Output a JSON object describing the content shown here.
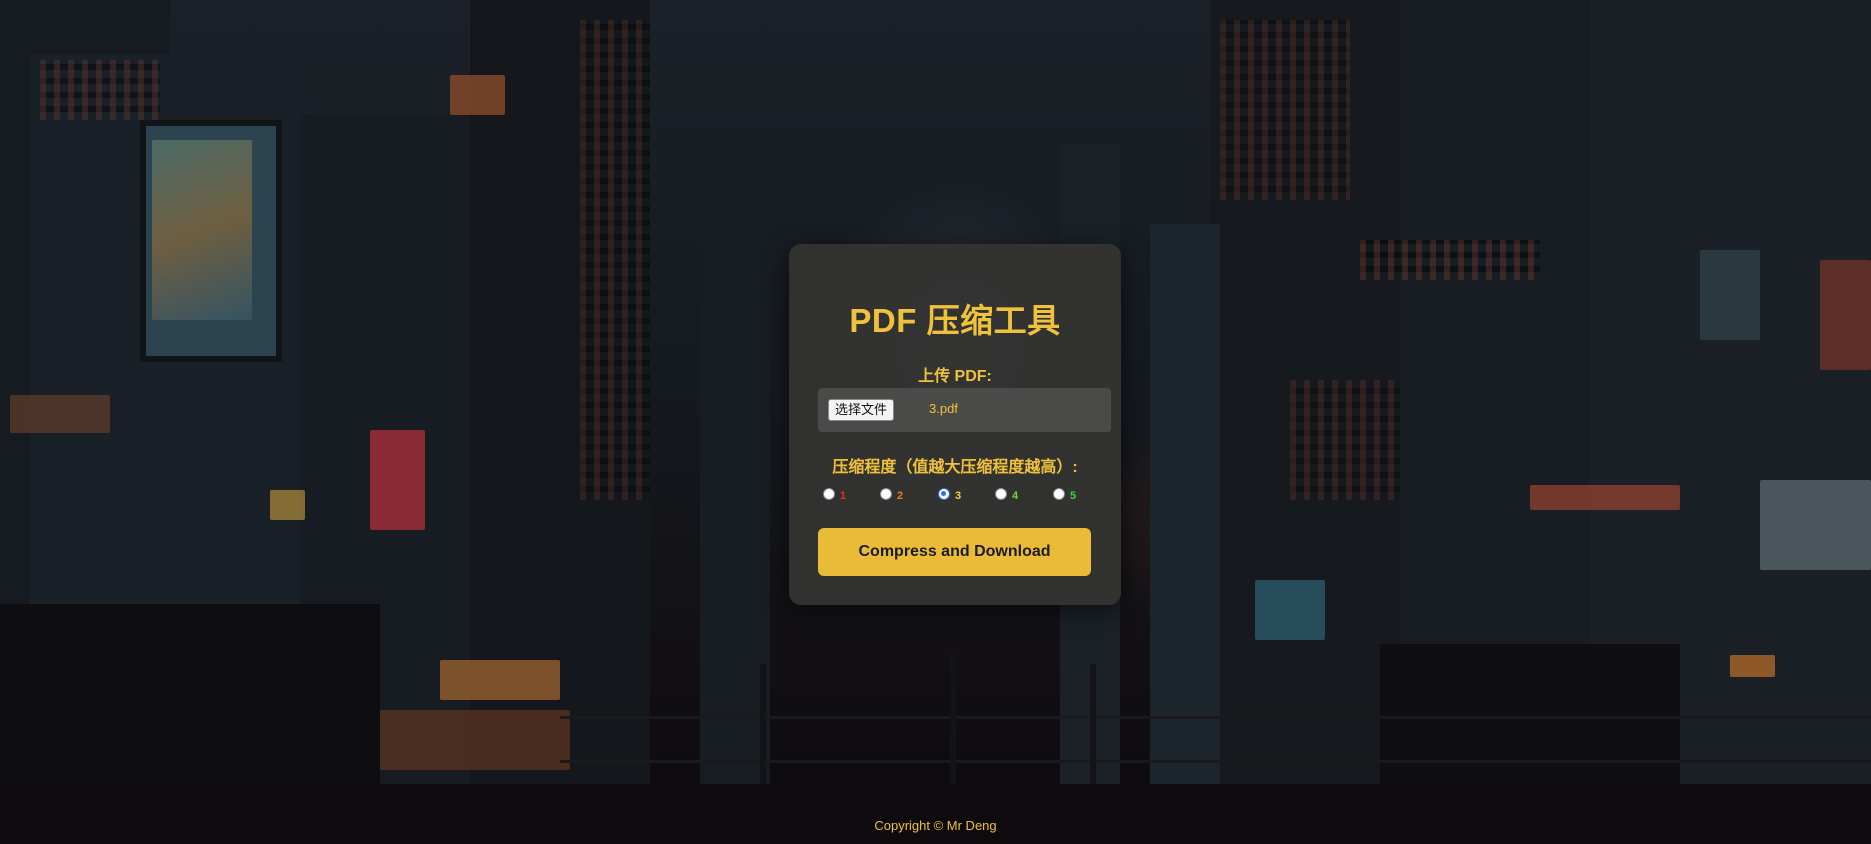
{
  "card": {
    "title": "PDF 压缩工具",
    "upload_label": "上传 PDF:",
    "file_button_label": "选择文件",
    "file_name": "3.pdf",
    "level_label": "压缩程度（值越大压缩程度越高）:",
    "levels": [
      {
        "label": "1",
        "color": "#e0331f",
        "checked": false
      },
      {
        "label": "2",
        "color": "#f07a1e",
        "checked": false
      },
      {
        "label": "3",
        "color": "#f3d23a",
        "checked": true
      },
      {
        "label": "4",
        "color": "#7ccf3a",
        "checked": false
      },
      {
        "label": "5",
        "color": "#39d43c",
        "checked": false
      }
    ],
    "submit_label": "Compress and Download"
  },
  "footer": {
    "copyright": "Copyright © Mr Deng"
  },
  "colors": {
    "accent": "#f0c23b",
    "button": "#eabb36",
    "card_bg": "#343432"
  }
}
